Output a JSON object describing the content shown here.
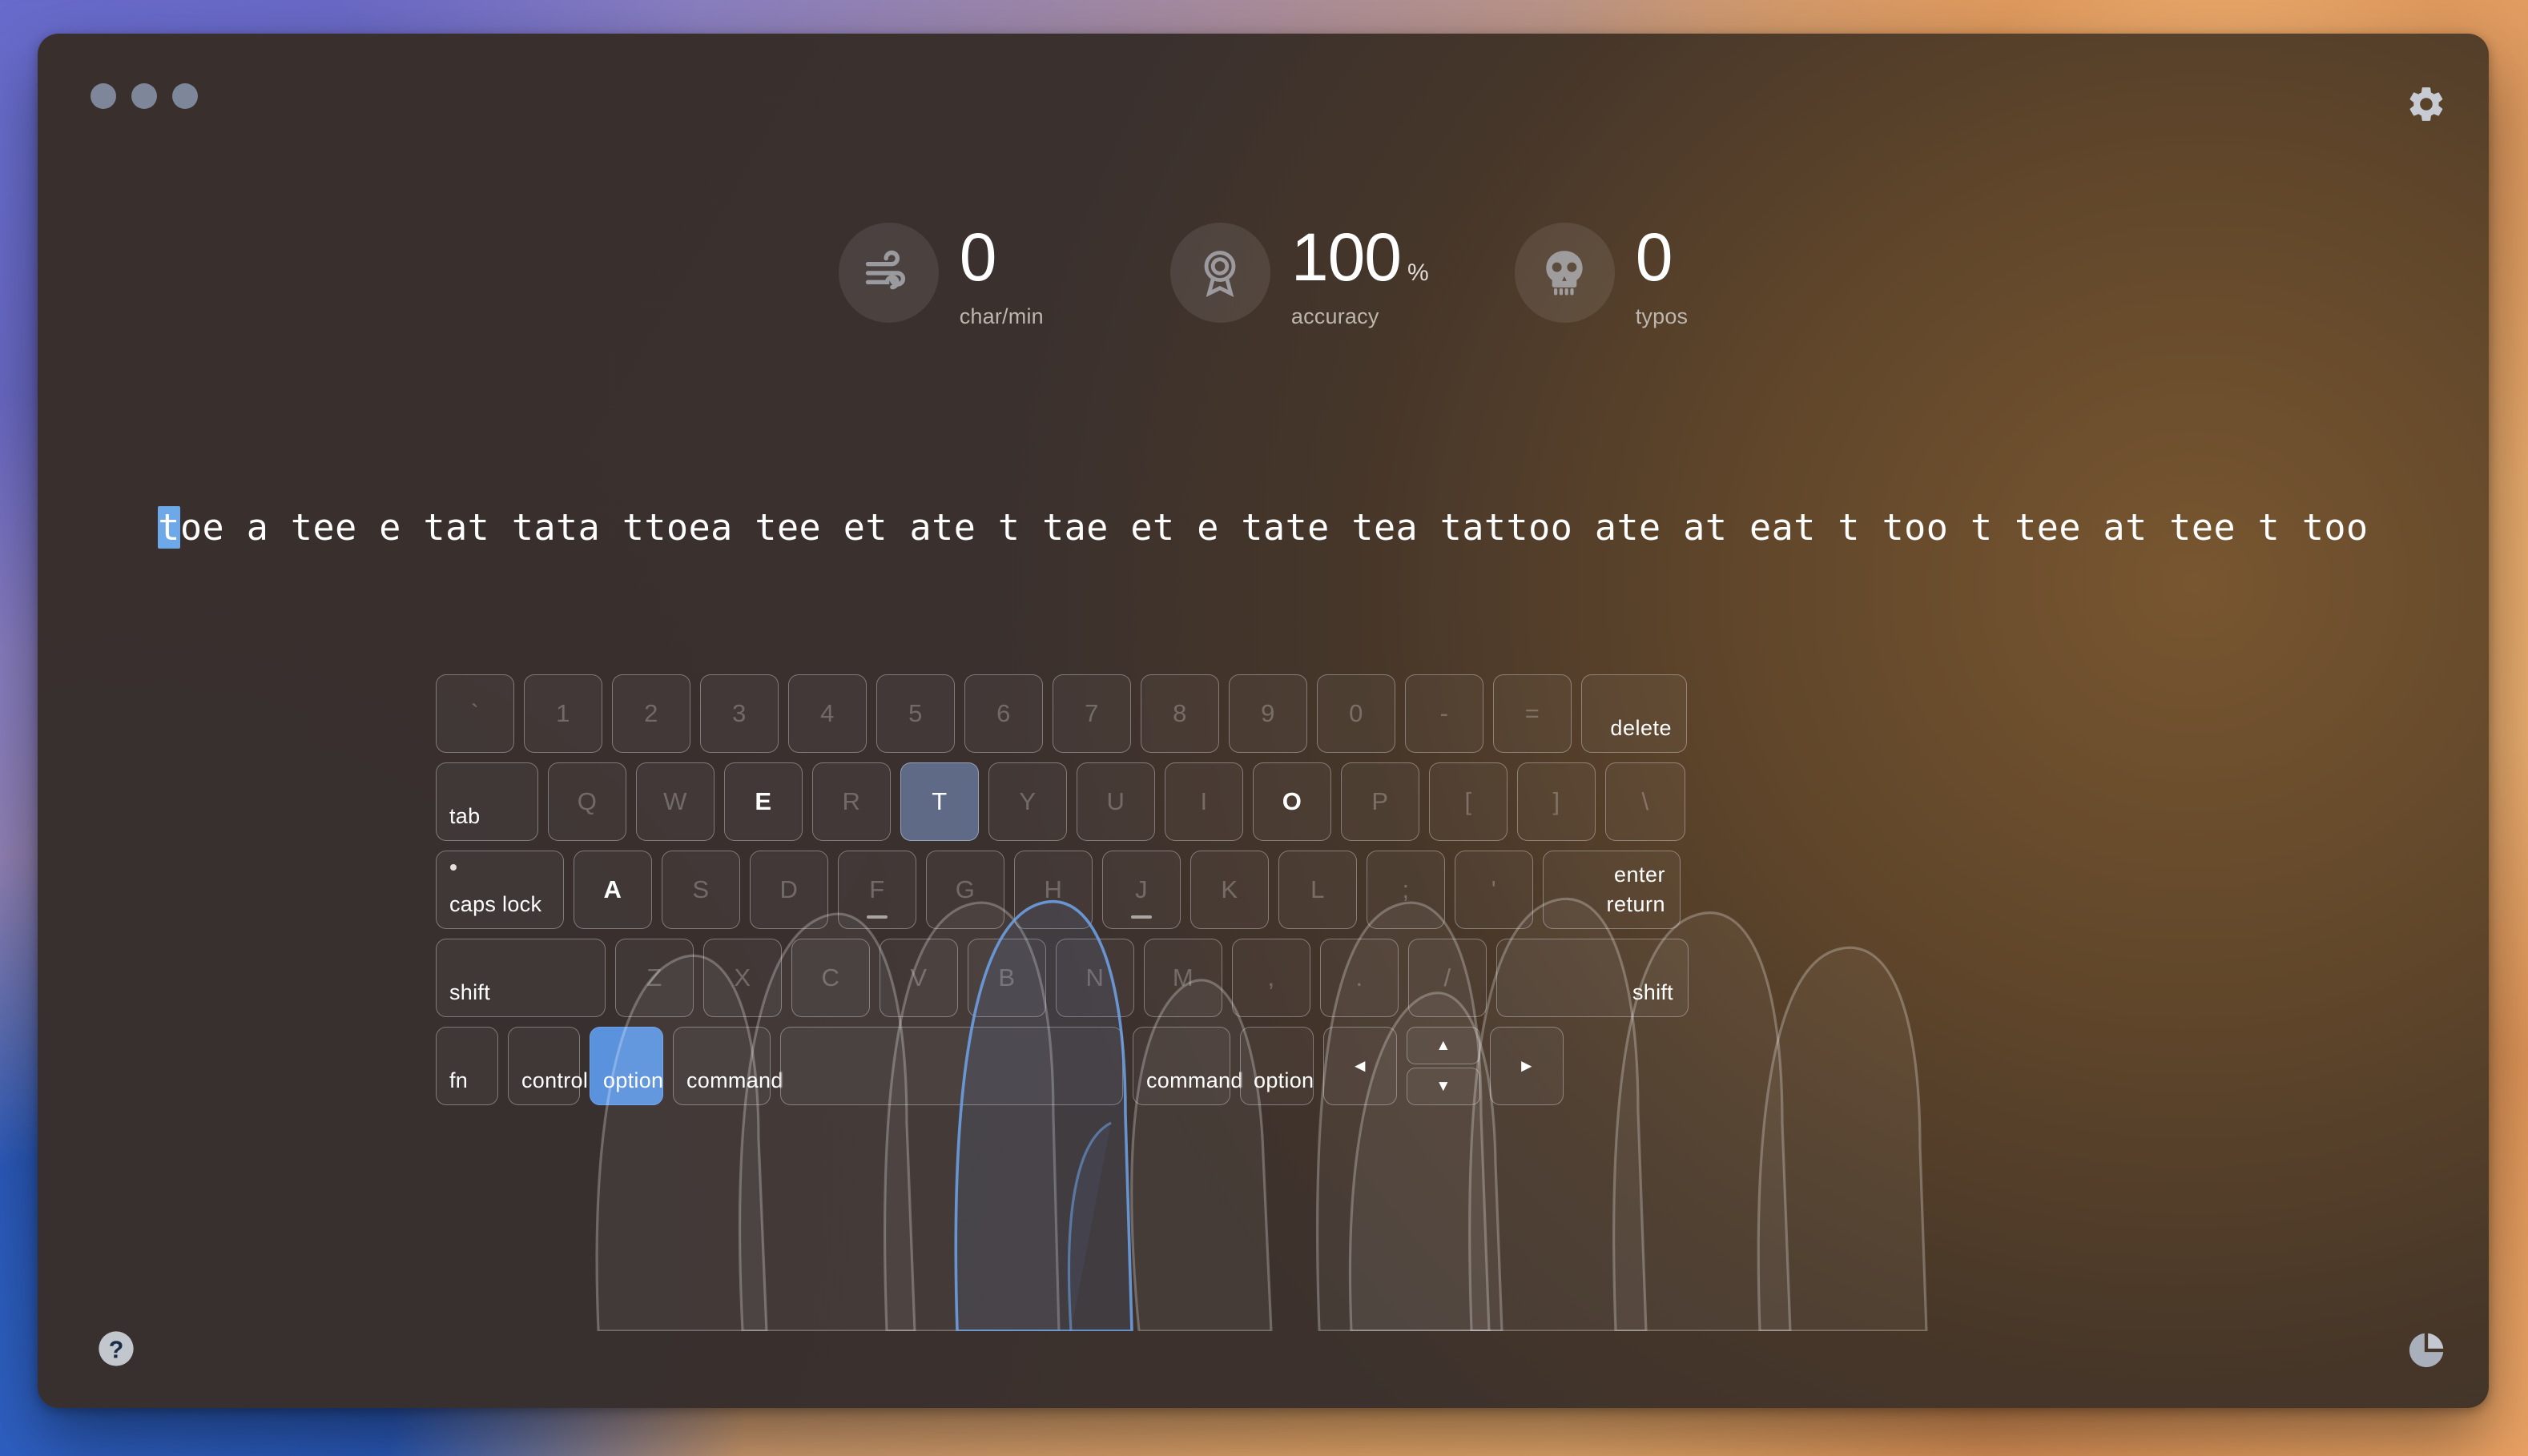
{
  "window": {
    "traffic_lights": [
      "close",
      "minimize",
      "maximize"
    ],
    "settings_icon": "gear-icon",
    "help_icon": "question-mark-icon",
    "stats_icon": "pie-chart-icon"
  },
  "stats": [
    {
      "icon": "wind-speed-icon",
      "value": "0",
      "unit": "",
      "label": "char/min"
    },
    {
      "icon": "award-medal-icon",
      "value": "100",
      "unit": "%",
      "label": "accuracy"
    },
    {
      "icon": "skull-icon",
      "value": "0",
      "unit": "",
      "label": "typos"
    }
  ],
  "typing": {
    "cursor_char": "t",
    "remaining_text": "oe a tee e tat tata ttoea tee et ate t tae et e tate tea tattoo ate at eat t too t tee at tee t too",
    "full_text": "toe a tee e tat tata ttoea tee et ate t tae et e tate tea tattoo ate at eat t too t tee at tee t too",
    "cursor_color": "#6da8e8"
  },
  "colors": {
    "key_highlight_slate": "#5f6a86",
    "key_highlight_blue": "#5b92dd",
    "key_border": "rgba(222,222,230,0.40)",
    "text_bright": "#ffffff",
    "text_dim": "rgba(226,222,226,0.30)"
  },
  "keyboard": {
    "row1": [
      {
        "label": "`",
        "state": "dim"
      },
      {
        "label": "1",
        "state": "dim"
      },
      {
        "label": "2",
        "state": "dim"
      },
      {
        "label": "3",
        "state": "dim"
      },
      {
        "label": "4",
        "state": "dim"
      },
      {
        "label": "5",
        "state": "dim"
      },
      {
        "label": "6",
        "state": "dim"
      },
      {
        "label": "7",
        "state": "dim"
      },
      {
        "label": "8",
        "state": "dim"
      },
      {
        "label": "9",
        "state": "dim"
      },
      {
        "label": "0",
        "state": "dim"
      },
      {
        "label": "-",
        "state": "dim"
      },
      {
        "label": "=",
        "state": "dim"
      },
      {
        "label": "delete",
        "state": "mod"
      }
    ],
    "row2": [
      {
        "label": "tab",
        "state": "mod"
      },
      {
        "label": "Q",
        "state": "dim"
      },
      {
        "label": "W",
        "state": "dim"
      },
      {
        "label": "E",
        "state": "bright"
      },
      {
        "label": "R",
        "state": "dim"
      },
      {
        "label": "T",
        "state": "active-slate"
      },
      {
        "label": "Y",
        "state": "dim"
      },
      {
        "label": "U",
        "state": "dim"
      },
      {
        "label": "I",
        "state": "dim"
      },
      {
        "label": "O",
        "state": "bright"
      },
      {
        "label": "P",
        "state": "dim"
      },
      {
        "label": "[",
        "state": "dim"
      },
      {
        "label": "]",
        "state": "dim"
      },
      {
        "label": "\\",
        "state": "dim"
      }
    ],
    "row3": [
      {
        "label": "caps lock",
        "state": "mod"
      },
      {
        "label": "A",
        "state": "bright"
      },
      {
        "label": "S",
        "state": "dim"
      },
      {
        "label": "D",
        "state": "dim"
      },
      {
        "label": "F",
        "state": "dim"
      },
      {
        "label": "G",
        "state": "dim"
      },
      {
        "label": "H",
        "state": "dim"
      },
      {
        "label": "J",
        "state": "dim"
      },
      {
        "label": "K",
        "state": "dim"
      },
      {
        "label": "L",
        "state": "dim"
      },
      {
        "label": ";",
        "state": "dim"
      },
      {
        "label": "'",
        "state": "dim"
      },
      {
        "label_top": "enter",
        "label_bottom": "return",
        "state": "mod"
      }
    ],
    "row4": [
      {
        "label": "shift",
        "state": "mod"
      },
      {
        "label": "Z",
        "state": "dim"
      },
      {
        "label": "X",
        "state": "dim"
      },
      {
        "label": "C",
        "state": "dim"
      },
      {
        "label": "V",
        "state": "dim"
      },
      {
        "label": "B",
        "state": "dim"
      },
      {
        "label": "N",
        "state": "dim"
      },
      {
        "label": "M",
        "state": "dim"
      },
      {
        "label": ",",
        "state": "dim"
      },
      {
        "label": ".",
        "state": "dim"
      },
      {
        "label": "/",
        "state": "dim"
      },
      {
        "label": "shift",
        "state": "mod-right"
      }
    ],
    "row5": [
      {
        "label": "fn",
        "state": "mod"
      },
      {
        "label": "control",
        "state": "mod"
      },
      {
        "label": "option",
        "state": "active-blue"
      },
      {
        "label": "command",
        "state": "mod"
      },
      {
        "label": "",
        "state": "space"
      },
      {
        "label": "command",
        "state": "mod"
      },
      {
        "label": "option",
        "state": "mod"
      },
      {
        "label": "◄",
        "state": "arrow"
      },
      {
        "label_up": "▲",
        "label_down": "▼",
        "state": "arrow-stack"
      },
      {
        "label": "►",
        "state": "arrow"
      }
    ]
  }
}
